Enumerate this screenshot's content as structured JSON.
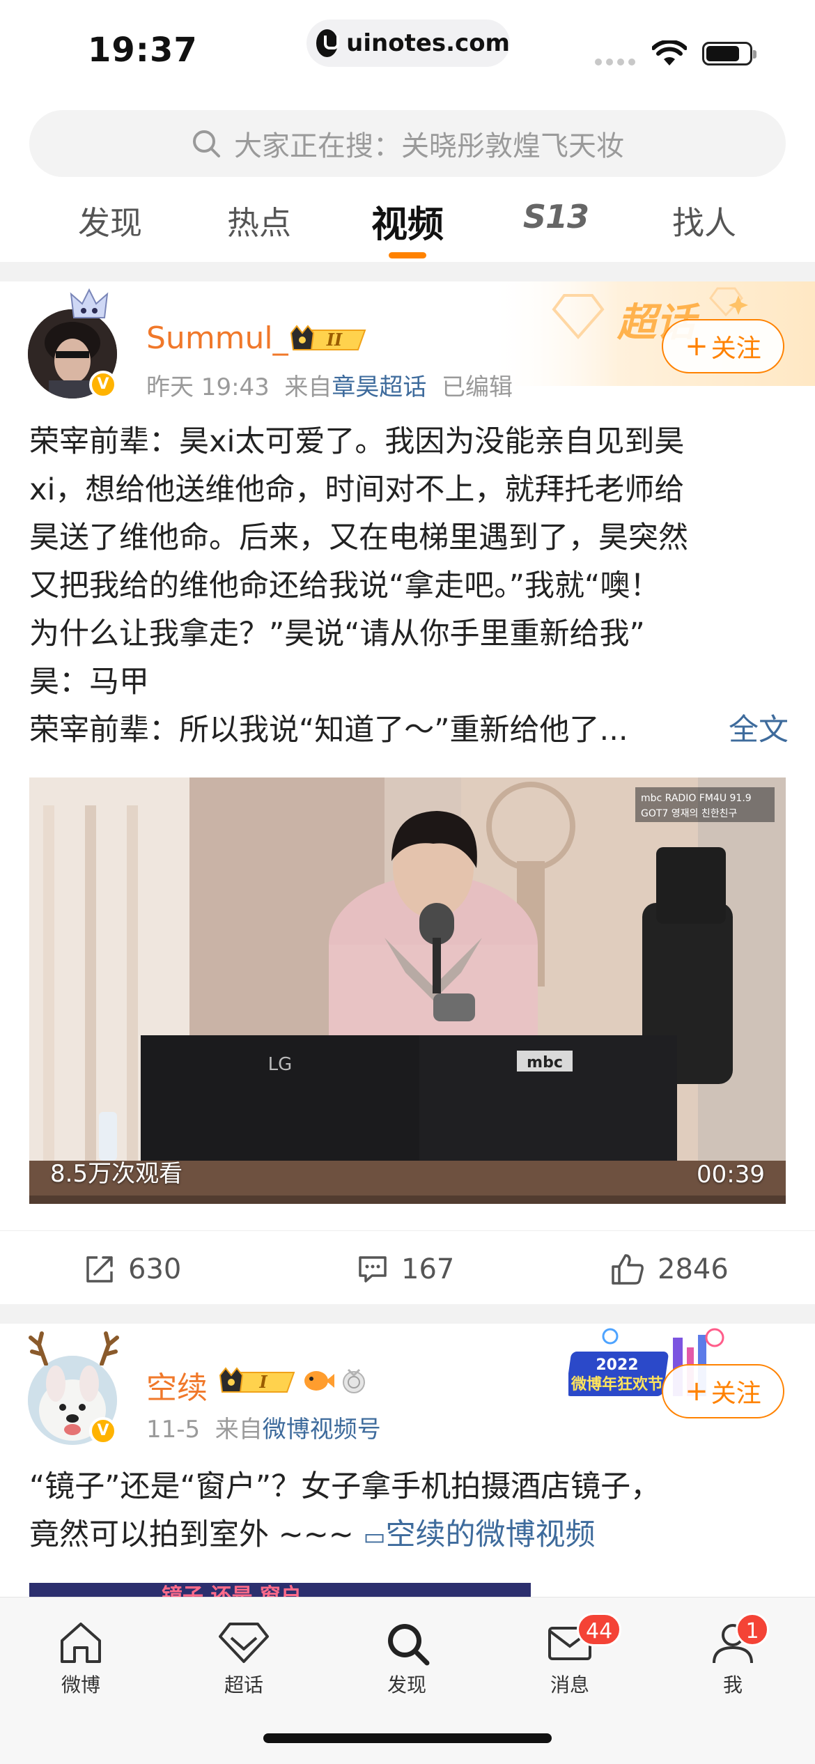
{
  "status_bar": {
    "time": "19:37",
    "url": "uinotes.com"
  },
  "search": {
    "placeholder": "大家正在搜：关晓彤敦煌飞天妆"
  },
  "tabs": [
    {
      "label": "发现"
    },
    {
      "label": "热点"
    },
    {
      "label": "视频"
    },
    {
      "label": "S13"
    },
    {
      "label": "找人"
    }
  ],
  "active_tab": "视频",
  "accent_color": "#ff8200",
  "posts": [
    {
      "username": "Summul_",
      "level_badge": "II",
      "time": "昨天 19:43",
      "from_prefix": "来自",
      "source": "章昊超话",
      "edited": "已编辑",
      "follow_label": "关注",
      "banner_text": "超话",
      "text_lines": [
        "荣宰前辈：昊xi太可爱了。我因为没能亲自见到昊",
        "xi，想给他送维他命，时间对不上，就拜托老师给",
        "昊送了维他命。后来，又在电梯里遇到了，昊突然",
        "又把我给的维他命还给我说“拿走吧。”我就“噢！",
        "为什么让我拿走？”昊说“请从你手里重新给我”",
        "昊：马甲",
        "荣宰前辈：所以我说“知道了～”重新给他了..."
      ],
      "full_text_link": "全文",
      "video": {
        "views": "8.5万次观看",
        "duration": "00:39",
        "overlay_top_right": "mbc RADIO FM4U 91.9",
        "overlay_sub": "GOT7 영재의 친한친구",
        "brand_lg": "LG",
        "brand_mbc": "mbc"
      },
      "actions": {
        "repost": "630",
        "comment": "167",
        "like": "2846"
      }
    },
    {
      "username": "空续",
      "level_badge": "I",
      "time": "11-5",
      "from_prefix": "来自",
      "source": "微博视频号",
      "follow_label": "关注",
      "banner_year": "2022",
      "banner_text": "微博年狂欢节",
      "text_lines": [
        "“镜子”还是“窗户”？女子拿手机拍摄酒店镜子，",
        "竟然可以拍到室外 ~~~"
      ],
      "video_link": "空续的微博视频",
      "thumb_text": "镜子 还是 窗户"
    }
  ],
  "tab_bar": [
    {
      "label": "微博",
      "icon": "home-icon"
    },
    {
      "label": "超话",
      "icon": "diamond-icon"
    },
    {
      "label": "发现",
      "icon": "discover-icon"
    },
    {
      "label": "消息",
      "icon": "mail-icon",
      "badge": "44"
    },
    {
      "label": "我",
      "icon": "profile-icon",
      "badge": "1"
    }
  ]
}
